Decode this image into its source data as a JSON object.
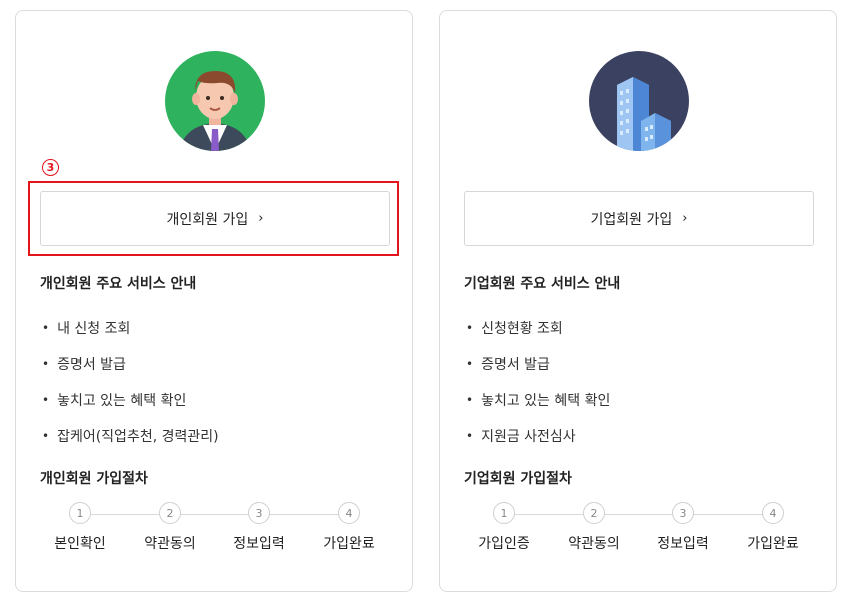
{
  "annotation": {
    "marker": "3"
  },
  "personal": {
    "join_button": "개인회원 가입",
    "join_chevron": "›",
    "services_title": "개인회원 주요 서비스 안내",
    "services": [
      "내 신청 조회",
      "증명서 발급",
      "놓치고 있는 혜택 확인",
      "잡케어(직업추천, 경력관리)"
    ],
    "process_title": "개인회원 가입절차",
    "steps": [
      {
        "num": "1",
        "label": "본인확인"
      },
      {
        "num": "2",
        "label": "약관동의"
      },
      {
        "num": "3",
        "label": "정보입력"
      },
      {
        "num": "4",
        "label": "가입완료"
      }
    ],
    "icon": "businessman-avatar-icon"
  },
  "corporate": {
    "join_button": "기업회원 가입",
    "join_chevron": "›",
    "services_title": "기업회원 주요 서비스 안내",
    "services": [
      "신청현황 조회",
      "증명서 발급",
      "놓치고 있는 혜택 확인",
      "지원금 사전심사"
    ],
    "process_title": "기업회원 가입절차",
    "steps": [
      {
        "num": "1",
        "label": "가입인증"
      },
      {
        "num": "2",
        "label": "약관동의"
      },
      {
        "num": "3",
        "label": "정보입력"
      },
      {
        "num": "4",
        "label": "가입완료"
      }
    ],
    "icon": "office-building-icon"
  },
  "colors": {
    "highlight": "#e4141b",
    "avatar_personal_bg": "#2fb25d",
    "avatar_corporate_bg": "#3b4160"
  }
}
